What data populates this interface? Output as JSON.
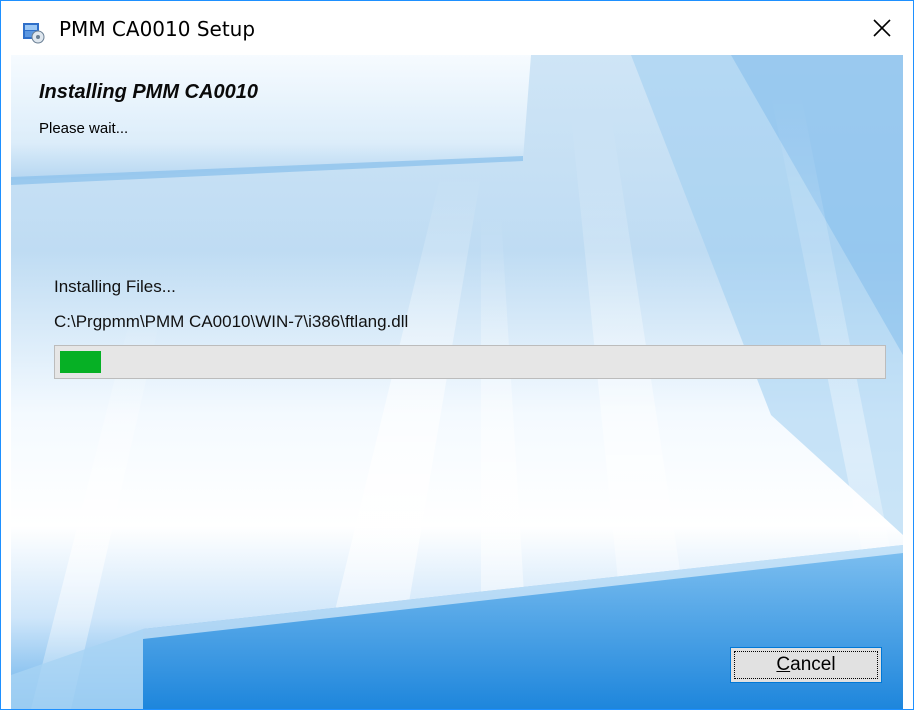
{
  "window": {
    "title": "PMM CA0010 Setup",
    "close_glyph": "✕",
    "icons": {
      "app": "installer-package-icon",
      "close": "close-icon"
    }
  },
  "header": {
    "title": "Installing PMM CA0010",
    "subtitle": "Please wait..."
  },
  "progress": {
    "status": "Installing Files...",
    "current_file": "C:\\Prgpmm\\PMM CA0010\\WIN-7\\i386\\ftlang.dll",
    "percent": 5,
    "fill_color": "#06b025"
  },
  "buttons": {
    "cancel_mnemonic": "C",
    "cancel_rest": "ancel"
  },
  "colors": {
    "window_border": "#1e90ff",
    "button_focus_border": "#0078d7"
  }
}
